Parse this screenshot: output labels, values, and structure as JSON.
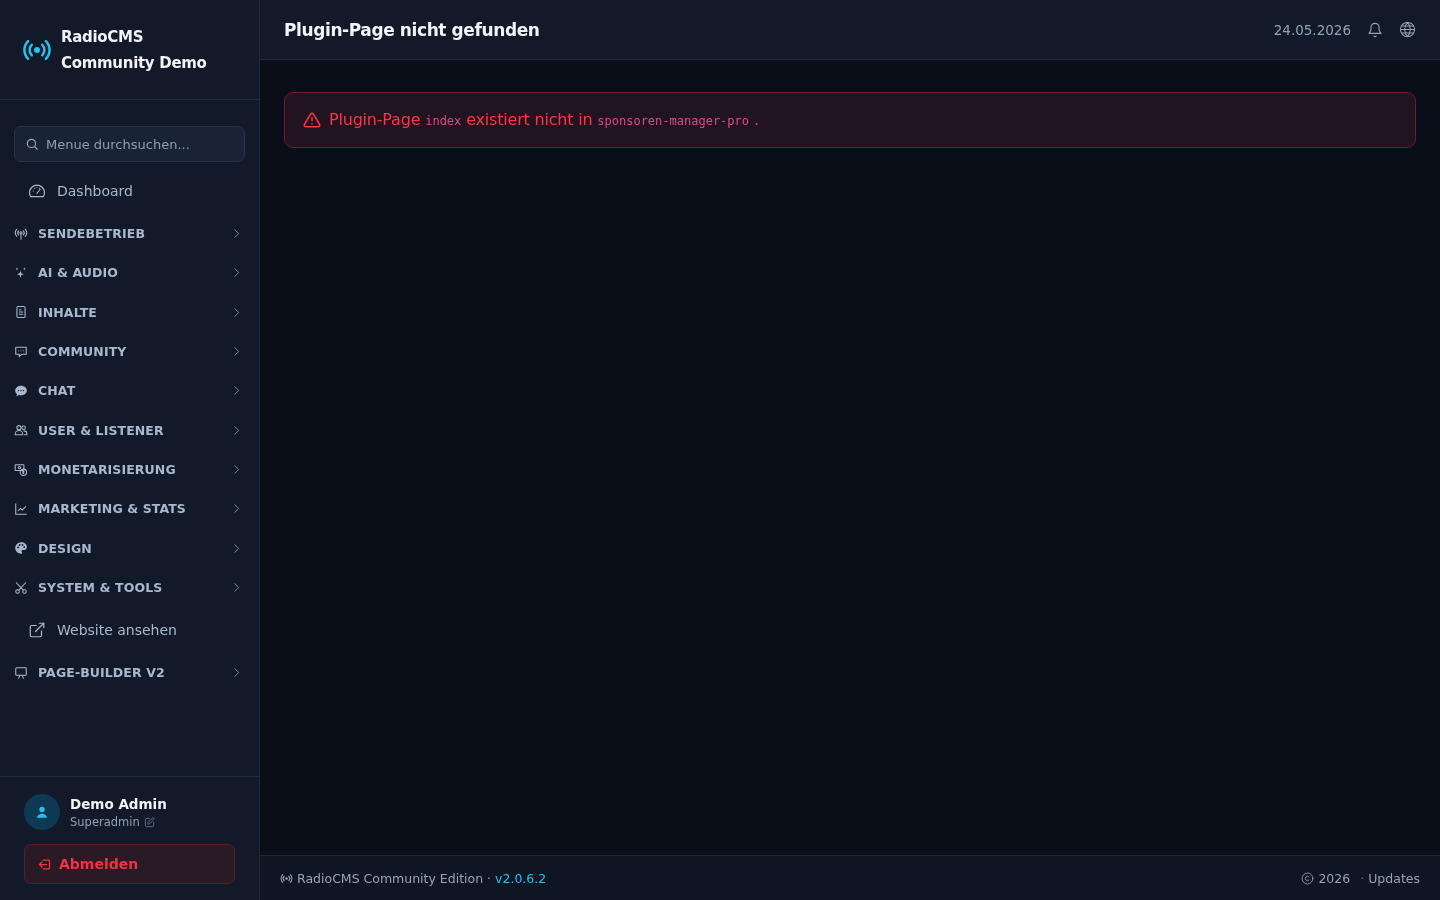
{
  "sidebar": {
    "brand": {
      "title": "RadioCMS Community Demo"
    },
    "search": {
      "placeholder": "Menue durchsuchen..."
    },
    "items": [
      {
        "kind": "link",
        "label": "Dashboard"
      },
      {
        "kind": "group",
        "label": "SENDEBETRIEB",
        "expanded": false
      },
      {
        "kind": "group",
        "label": "AI & AUDIO",
        "expanded": false
      },
      {
        "kind": "group",
        "label": "INHALTE",
        "expanded": false
      },
      {
        "kind": "group",
        "label": "COMMUNITY",
        "expanded": false
      },
      {
        "kind": "group",
        "label": "CHAT",
        "expanded": false
      },
      {
        "kind": "group",
        "label": "USER & LISTENER",
        "expanded": false
      },
      {
        "kind": "group",
        "label": "MONETARISIERUNG",
        "expanded": false
      },
      {
        "kind": "group",
        "label": "MARKETING & STATS",
        "expanded": false
      },
      {
        "kind": "group",
        "label": "DESIGN",
        "expanded": false
      },
      {
        "kind": "group",
        "label": "SYSTEM & TOOLS",
        "expanded": false
      },
      {
        "kind": "link",
        "label": "Website ansehen"
      },
      {
        "kind": "group",
        "label": "PAGE-BUILDER V2",
        "expanded": false
      }
    ],
    "user": {
      "name": "Demo Admin",
      "role": "Superadmin"
    },
    "logout": {
      "label": "Abmelden"
    }
  },
  "header": {
    "title": "Plugin-Page nicht gefunden",
    "date": "24.05.2026"
  },
  "alert": {
    "segments": [
      {
        "kind": "text",
        "text": "Plugin-Page"
      },
      {
        "kind": "code",
        "text": "index"
      },
      {
        "kind": "text",
        "text": "existiert nicht in"
      },
      {
        "kind": "code",
        "text": "sponsoren-manager-pro"
      },
      {
        "kind": "text",
        "text": "."
      }
    ]
  },
  "footer": {
    "edition": "RadioCMS Community Edition ·",
    "version": "v2.0.6.2",
    "year": "2026",
    "separator": "·",
    "link": "Updates"
  }
}
